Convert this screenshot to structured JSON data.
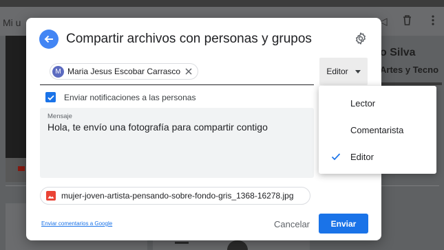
{
  "background": {
    "title": "Mi u",
    "person_name": "o Silva",
    "person_subtitle": "Artes y Tecno",
    "icons": [
      "share-icon",
      "trash-icon",
      "more-vertical-icon"
    ]
  },
  "dialog": {
    "title": "Compartir archivos con personas y grupos",
    "back_icon": "arrow-left-icon",
    "settings_icon": "gear-icon",
    "recipient": {
      "initial": "M",
      "name": "Maria Jesus Escobar Carrasco",
      "avatar_color": "#5c6bc0"
    },
    "role_selected": "Editor",
    "notify_label": "Enviar notificaciones a las personas",
    "notify_checked": true,
    "message": {
      "caption": "Mensaje",
      "text": "Hola, te envío una fotografía para compartir contigo"
    },
    "attachment": {
      "icon": "image-file-icon",
      "file_name": "mujer-joven-artista-pensando-sobre-fondo-gris_1368-16278.jpg"
    },
    "feedback_link": "Enviar comentarios a Google",
    "cancel_label": "Cancelar",
    "send_label": "Enviar"
  },
  "role_menu": {
    "items": [
      {
        "label": "Lector",
        "selected": false
      },
      {
        "label": "Comentarista",
        "selected": false
      },
      {
        "label": "Editor",
        "selected": true
      }
    ]
  },
  "colors": {
    "accent": "#1a73e8",
    "back_button": "#4285f4",
    "overlay": "#5f6163"
  }
}
